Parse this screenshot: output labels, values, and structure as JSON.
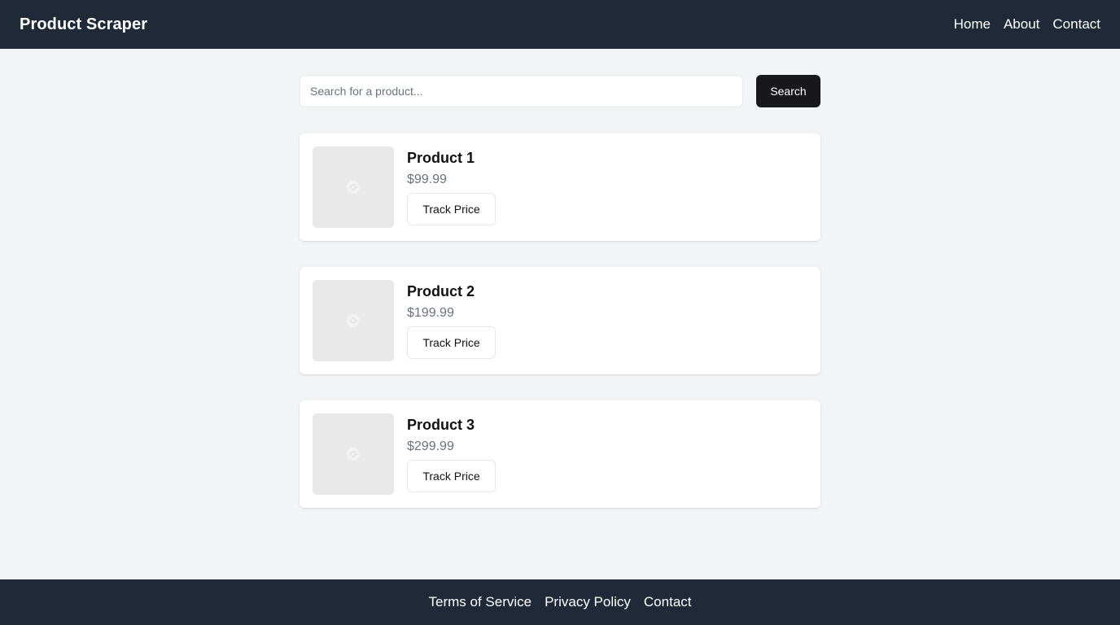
{
  "header": {
    "title": "Product Scraper",
    "nav": [
      "Home",
      "About",
      "Contact"
    ]
  },
  "search": {
    "placeholder": "Search for a product...",
    "value": "",
    "button_label": "Search"
  },
  "products": [
    {
      "name": "Product 1",
      "price": "$99.99",
      "button_label": "Track Price",
      "image_icon": "image-placeholder-icon"
    },
    {
      "name": "Product 2",
      "price": "$199.99",
      "button_label": "Track Price",
      "image_icon": "image-placeholder-icon"
    },
    {
      "name": "Product 3",
      "price": "$299.99",
      "button_label": "Track Price",
      "image_icon": "image-placeholder-icon"
    }
  ],
  "footer": {
    "links": [
      "Terms of Service",
      "Privacy Policy",
      "Contact"
    ]
  },
  "colors": {
    "header_bg": "#1f2937",
    "page_bg": "#f3f4f6",
    "primary_button": "#18181b",
    "price_text": "#6b7280"
  }
}
